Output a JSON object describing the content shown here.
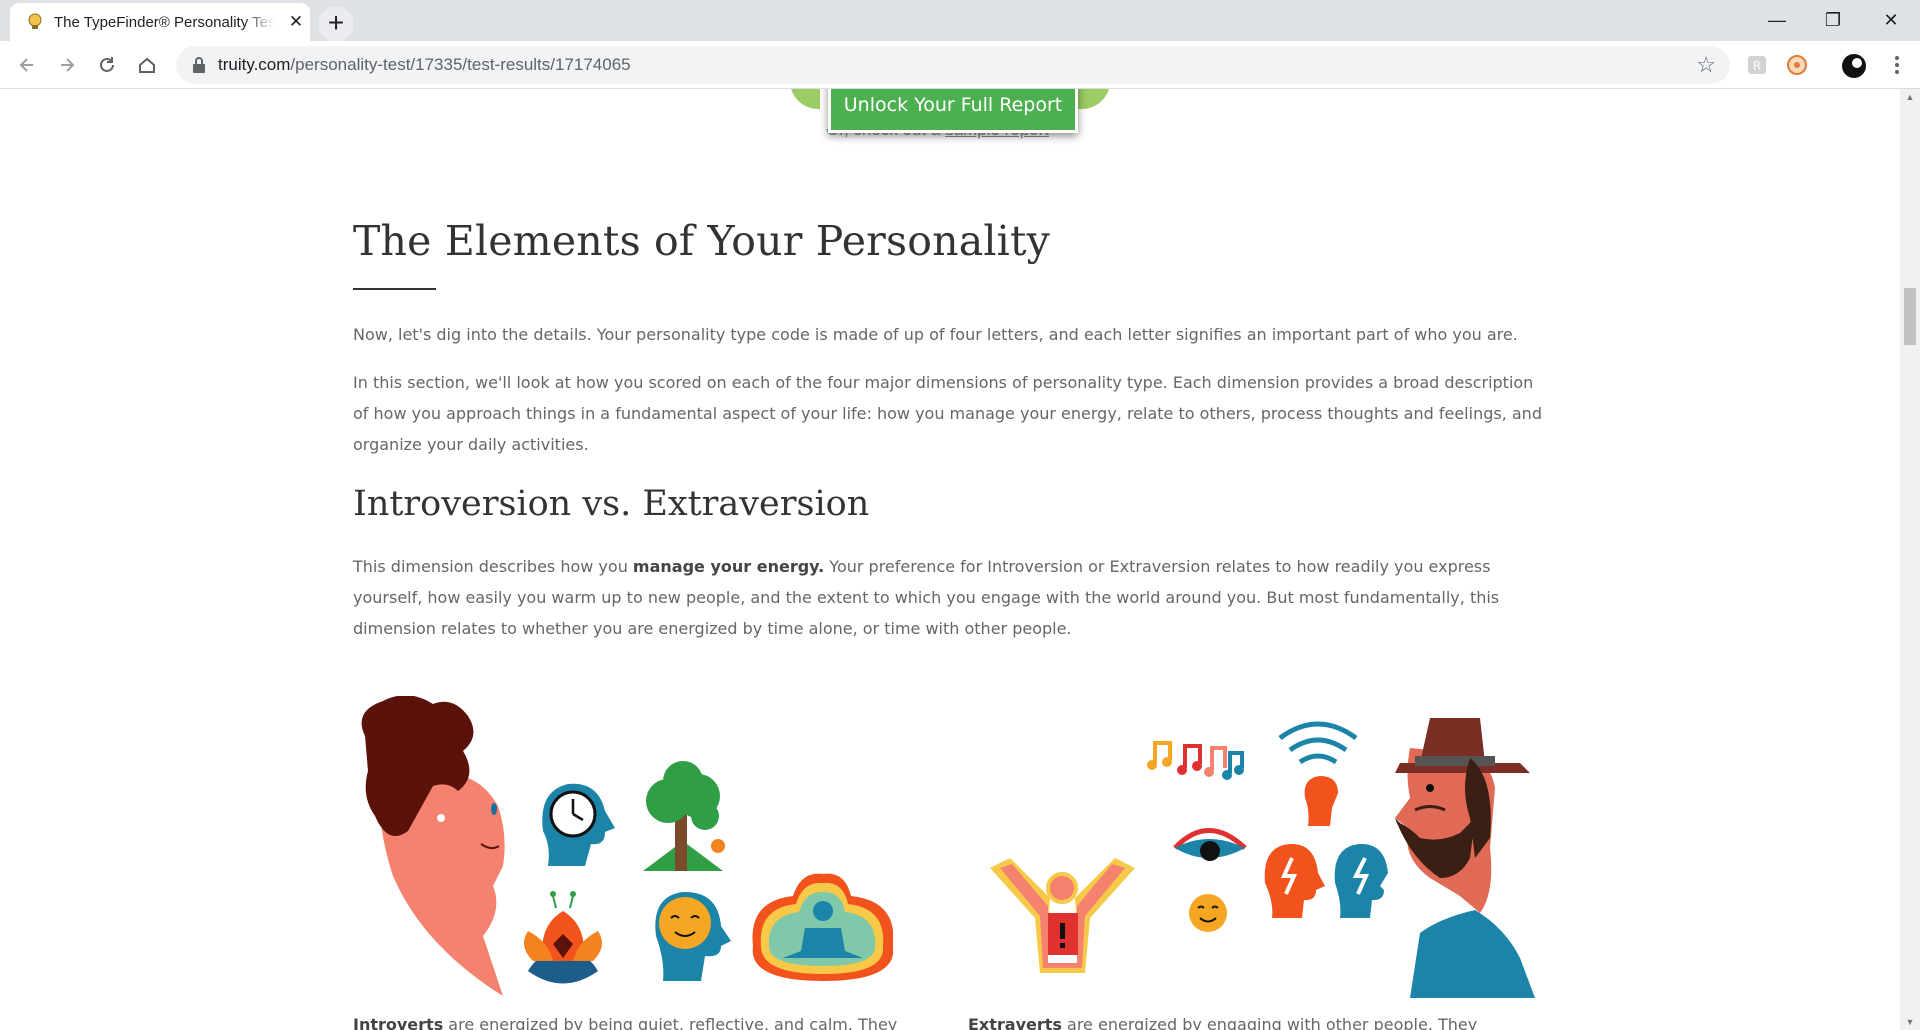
{
  "browser": {
    "tab_title": "The TypeFinder® Personality Test",
    "tab_close": "✕",
    "new_tab": "+",
    "url_host": "truity.com",
    "url_path": "/personality-test/17335/test-results/17174065",
    "window_minimize": "—",
    "window_restore": "❐",
    "window_close": "✕"
  },
  "cta": {
    "button_label": "Unlock Your Full Report",
    "sub_prefix": "Or, check out a ",
    "sub_link": "sample report"
  },
  "section": {
    "title": "The Elements of Your Personality",
    "intro_1": "Now, let's dig into the details. Your personality type code is made of up of four letters, and each letter signifies an important part of who you are.",
    "intro_2": "In this section, we'll look at how you scored on each of the four major dimensions of personality type. Each dimension provides a broad description of how you approach things in a fundamental aspect of your life: how you manage your energy, relate to others, process thoughts and feelings, and organize your daily activities."
  },
  "dimension": {
    "title": "Introversion vs. Extraversion",
    "desc_before": "This dimension describes how you ",
    "desc_bold": "manage your energy.",
    "desc_after": " Your preference for Introversion or Extraversion relates to how readily you express yourself, how easily you warm up to new people, and the extent to which you engage with the world around you. But most fundamentally, this dimension relates to whether you are energized by time alone, or time with other people.",
    "introverts_bold": "Introverts",
    "introverts_text": " are energized by being quiet, reflective, and calm. They",
    "extraverts_bold": "Extraverts",
    "extraverts_text": " are energized by engaging with other people. They"
  },
  "colors": {
    "cta_green": "#4caf50",
    "cta_light_green": "#9ccc65",
    "heading": "#333333",
    "body_text": "#666666"
  },
  "icons": [
    "favicon-bulb-icon",
    "back-icon",
    "forward-icon",
    "reload-icon",
    "home-icon",
    "lock-icon",
    "star-icon",
    "extension-icon",
    "profile-icon",
    "menu-icon"
  ]
}
